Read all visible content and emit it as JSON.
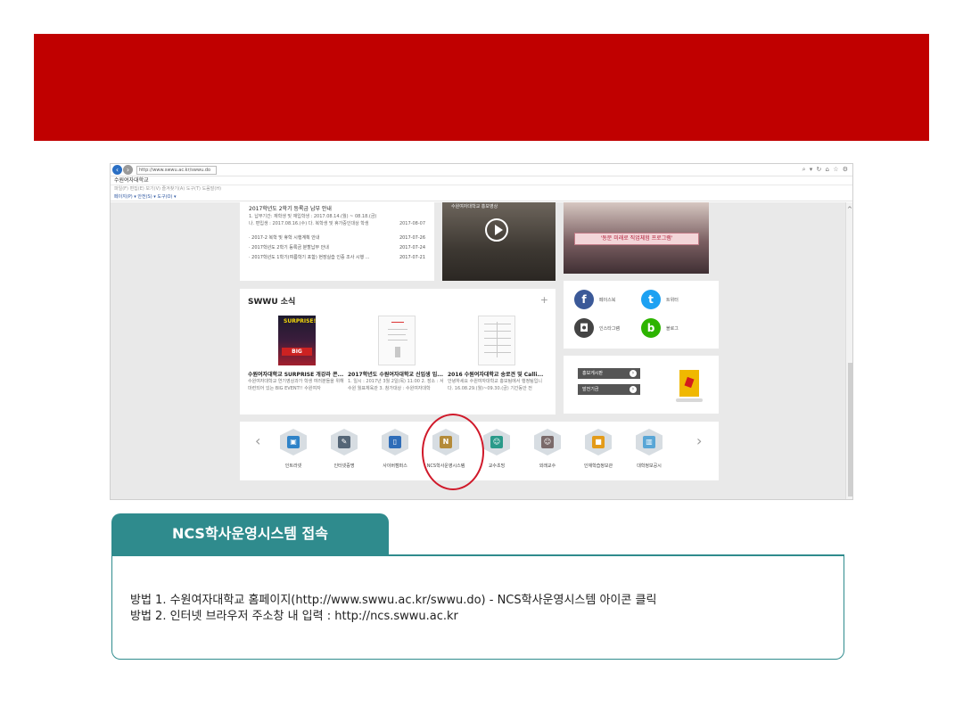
{
  "browser": {
    "url": "http://www.swwu.ac.kr/swwu.do",
    "tab_title": "수원여자대학교",
    "menu_bar": "파일(F)   편집(E)   보기(V)   즐겨찾기(A)   도구(T)   도움말(H)",
    "toolbar": "페이지(P) ▾   안전(S) ▾   도구(O) ▾",
    "top_right": "⌕ ▾ ↻   ⌂ ☆ ⚙"
  },
  "notice": {
    "headline": "2017학년도 2학기 등록금 납부 안내",
    "line1": "1. 납부기간: 재학생 및 재입학생 : 2017.08.14.(월) ~ 08.18.(금)",
    "line2": "나. 편입생 : 2017.08.16.(수) 다. 복학생 및 휴가중인대상 학생",
    "line2_date": "2017-08-07",
    "items": [
      {
        "text": "· 2017-2 복학 및 휴학 시행계획 안내",
        "date": "2017-07-26"
      },
      {
        "text": "· 2017학년도 2학기 등록금 분할납부 안내",
        "date": "2017-07-24"
      },
      {
        "text": "· 2017학년도 1학기(여름학기 포함) 현장실습 인증 조사 시행 ...",
        "date": "2017-07-21"
      }
    ]
  },
  "video": {
    "caption": "수원여자대학교 홍보영상"
  },
  "photo": {
    "banner": "'동문 미래로 직업체험 프로그램'"
  },
  "news": {
    "title": "SWWU 소식",
    "plus": "+",
    "items": [
      {
        "title": "수원여자대학교 SURPRISE 개강라 콘...",
        "desc": "수원여자대학교 연기영상과가 학생 여러분들을 위해 마련되어 있는 BIG EVENT!! 수원여자",
        "poster_top": "SURPRISE!",
        "poster_big": "BIG"
      },
      {
        "title": "2017학년도 수원여자대학교 신입생 입...",
        "desc": "1. 일시 : 2017년 3월 2일(목) 11:00 2. 장소 : 서수원 월표체육관 3. 참가대상 : 수원여자대학"
      },
      {
        "title": "2016 수원여자대학교 송로견 및 Calli...",
        "desc": "안녕하세요 수원여자대학교 홍보팀에서 행정팀입니다. 16.08.29.(월)~09.30.(금) 기간동안 전"
      }
    ]
  },
  "sns": [
    {
      "label": "페이스북",
      "glyph": "f",
      "color": "#3b5998"
    },
    {
      "label": "트위터",
      "glyph": "t",
      "color": "#1da1f2"
    },
    {
      "label": "인스타그램",
      "glyph": "◘",
      "color": "#444444"
    },
    {
      "label": "블로그",
      "glyph": "b",
      "color": "#2db400"
    }
  ],
  "promo": {
    "buttons": [
      "홍보게시판",
      "발전기금"
    ],
    "arrow": "›"
  },
  "icons": {
    "prev": "‹",
    "next": "›",
    "items": [
      {
        "label": "인트라넷",
        "color": "#2f83c8",
        "glyph": "▣"
      },
      {
        "label": "인터넷증명",
        "color": "#556677",
        "glyph": "✎"
      },
      {
        "label": "사이버캠퍼스",
        "color": "#2f6db8",
        "glyph": "▯"
      },
      {
        "label": "NCS학사운영시스템",
        "color": "#b48b3a",
        "glyph": "N"
      },
      {
        "label": "교수초빙",
        "color": "#2a9a8a",
        "glyph": "☺"
      },
      {
        "label": "외래교수",
        "color": "#7a6a6a",
        "glyph": "☺"
      },
      {
        "label": "인재학습정보관",
        "color": "#e39b1a",
        "glyph": "■"
      },
      {
        "label": "대학정보공시",
        "color": "#59a6d6",
        "glyph": "▥"
      }
    ]
  },
  "section_tag": "NCS학사운영시스템 접속",
  "instructions": [
    "방법 1. 수원여자대학교 홈페이지(http://www.swwu.ac.kr/swwu.do)  - NCS학사운영시스템 아이콘 클릭",
    "방법 2. 인터넷 브라우저 주소창 내 입력 : http://ncs.swwu.ac.kr"
  ],
  "colors": {
    "banner": "#c00000",
    "accent": "#2f8b8d",
    "highlight_circle": "#d0192a"
  }
}
